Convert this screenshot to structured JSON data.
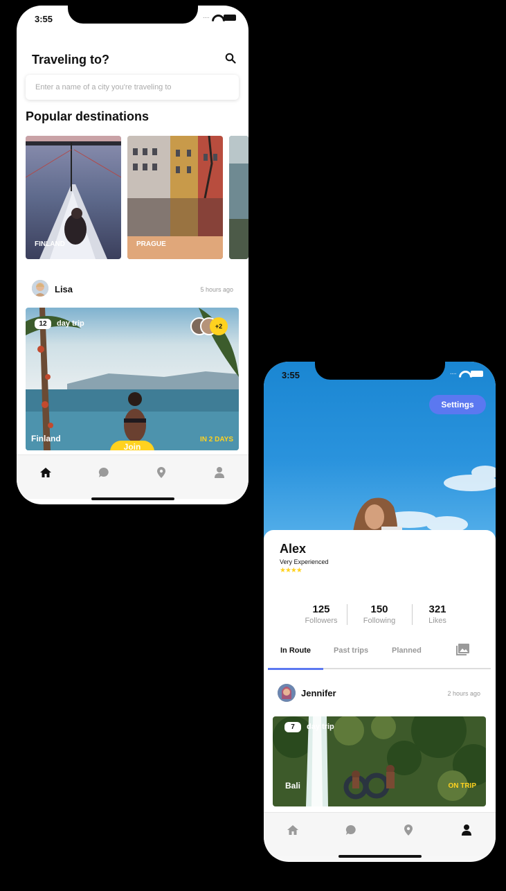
{
  "phone1": {
    "status": {
      "time": "3:55"
    },
    "header": {
      "title": "Traveling to?"
    },
    "search": {
      "placeholder": "Enter a name of a city you're traveling to"
    },
    "popular": {
      "title": "Popular destinations",
      "items": [
        {
          "label": "FINLAND"
        },
        {
          "label": "PRAGUE"
        }
      ]
    },
    "post": {
      "user": "Lisa",
      "time": "5 hours ago",
      "days": "12",
      "day_trip": "day trip",
      "extra_members": "+2",
      "place": "Finland",
      "status": "IN 2 DAYS",
      "join": "Join"
    },
    "tabs": [
      "home-icon",
      "chat-icon",
      "location-icon",
      "profile-icon"
    ]
  },
  "phone2": {
    "status": {
      "time": "3:55"
    },
    "settings": "Settings",
    "profile": {
      "name": "Alex",
      "level": "Very Experienced",
      "stars": "★★★★"
    },
    "stats": [
      {
        "value": "125",
        "label": "Followers"
      },
      {
        "value": "150",
        "label": "Following"
      },
      {
        "value": "321",
        "label": "Likes"
      }
    ],
    "tabs": [
      {
        "label": "In Route"
      },
      {
        "label": "Past trips"
      },
      {
        "label": "Planned"
      }
    ],
    "post": {
      "user": "Jennifer",
      "time": "2 hours ago",
      "days": "7",
      "day_trip": "day trip",
      "place": "Bali",
      "status": "ON TRIP"
    },
    "nav": [
      "home-icon",
      "chat-icon",
      "location-icon",
      "profile-icon"
    ]
  },
  "colors": {
    "accent": "#5b78f0",
    "highlight": "#ffd21f",
    "sky": "#1a86d2"
  }
}
